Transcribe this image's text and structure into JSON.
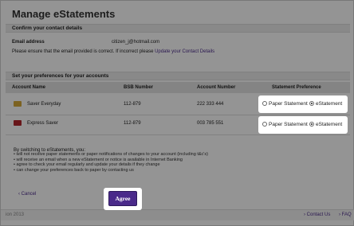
{
  "page": {
    "title": "Manage eStatements"
  },
  "contact": {
    "heading": "Confirm your contact details",
    "email_label": "Email address",
    "email_value": "citizen_j@hotmail.com",
    "note": "Please ensure that the email provided is correct.  If incorrect please",
    "update_link": "Update your Contact Details"
  },
  "prefs": {
    "heading": "Set your preferences for your accounts",
    "columns": [
      "Account Name",
      "BSB Number",
      "Account Number",
      "Statement Preference"
    ],
    "rows": [
      {
        "name": "Saver Everyday",
        "bsb": "112-879",
        "account": "222 333 444",
        "paper_label": "Paper Statement",
        "e_label": "eStatement",
        "selected": "eStatement",
        "icon": "gold-card-icon"
      },
      {
        "name": "Express Saver",
        "bsb": "112-879",
        "account": "003 785 551",
        "paper_label": "Paper Statement",
        "e_label": "eStatement",
        "selected": "eStatement",
        "icon": "red-card-icon"
      }
    ]
  },
  "terms": {
    "intro": "By switching to eStatements, you:",
    "items": [
      "will not receive paper statements or paper notifications of changes to your account (including t&c's)",
      "will receive an email when a new eStatement or notice is available in Internet Banking",
      "agree to check your email regularly and update your details if they change",
      "can change your preferences back to paper by contacting us"
    ]
  },
  "actions": {
    "cancel": "Cancel",
    "agree": "Agree"
  },
  "footer": {
    "left": "ion 2013",
    "contact": "Contact Us",
    "faq": "FAQ"
  },
  "colors": {
    "brand": "#4a2a8a"
  }
}
